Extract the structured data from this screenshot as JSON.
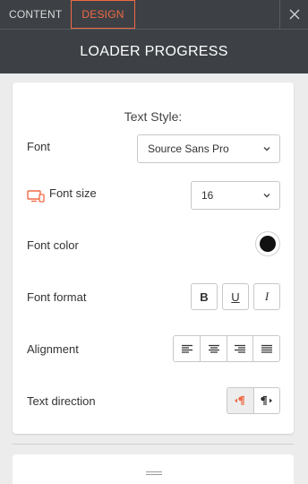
{
  "tabs": [
    {
      "label": "CONTENT",
      "active": false
    },
    {
      "label": "DESIGN",
      "active": true
    }
  ],
  "header": {
    "title": "LOADER PROGRESS"
  },
  "icons": {
    "close": "close-icon",
    "monitor": "monitor-icon",
    "chevron": "chevron-down-icon",
    "grip": "drag-handle-icon"
  },
  "text_style": {
    "section_title": "Text Style:",
    "font": {
      "label": "Font",
      "value": "Source Sans Pro"
    },
    "font_size": {
      "label": "Font size",
      "value": "16"
    },
    "font_color": {
      "label": "Font color",
      "value": "#111111"
    },
    "font_format": {
      "label": "Font format",
      "bold": "B",
      "underline": "U",
      "italic": "I"
    },
    "alignment": {
      "label": "Alignment",
      "options": [
        "left",
        "center",
        "right",
        "justify"
      ]
    },
    "text_direction": {
      "label": "Text direction",
      "options": [
        "ltr",
        "rtl"
      ],
      "selected": "ltr"
    }
  },
  "colors": {
    "accent": "#f06a45",
    "header_bg": "#3d4145",
    "page_bg": "#ececec"
  }
}
